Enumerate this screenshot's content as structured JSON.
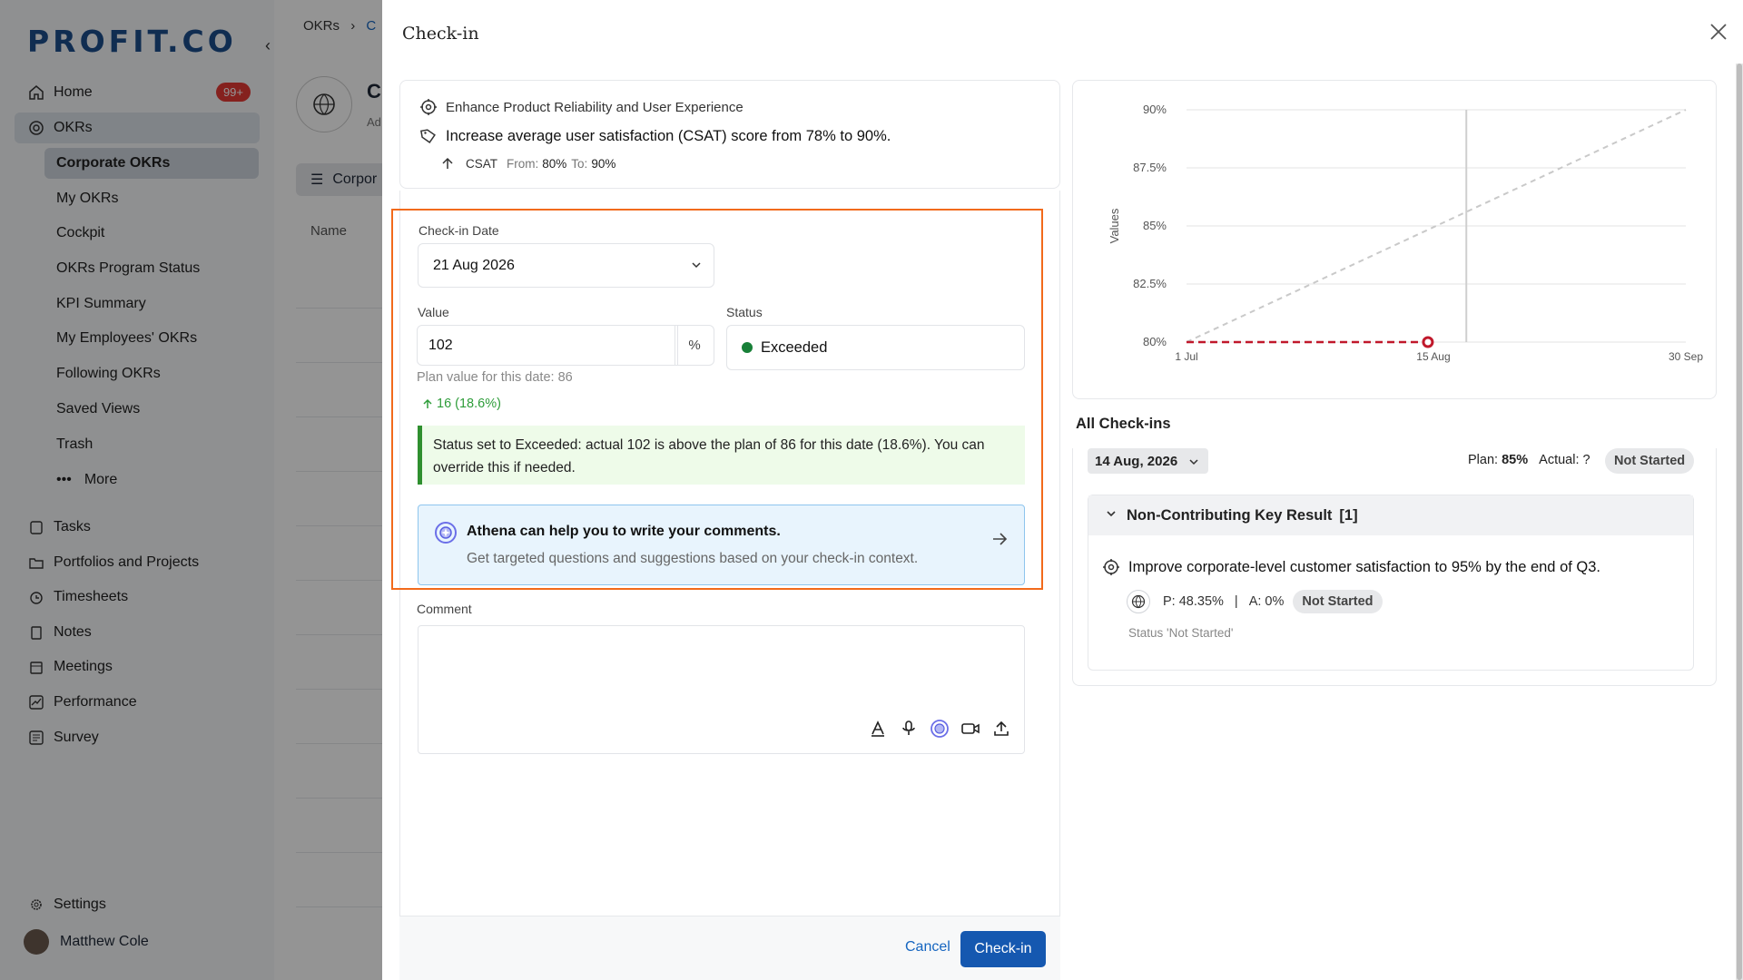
{
  "background": {
    "logo": "PROFIT.CO",
    "nav": [
      {
        "label": "Home",
        "badge": "99+"
      },
      {
        "label": "OKRs"
      },
      {
        "label": "Tasks"
      },
      {
        "label": "Portfolios and Projects"
      },
      {
        "label": "Timesheets"
      },
      {
        "label": "Notes"
      },
      {
        "label": "Meetings"
      },
      {
        "label": "Performance"
      },
      {
        "label": "Survey"
      }
    ],
    "okr_sub": [
      "Corporate OKRs",
      "My OKRs",
      "Cockpit",
      "OKRs Program Status",
      "KPI Summary",
      "My Employees' OKRs",
      "Following OKRs",
      "Saved Views",
      "Trash",
      "More"
    ],
    "settings": "Settings",
    "user": "Matthew Cole",
    "breadcrumb": [
      "OKRs",
      "C"
    ],
    "page_title": "C",
    "page_sub": "Ad",
    "filter": "Corpor",
    "name_col": "Name"
  },
  "drawer": {
    "title": "Check-in",
    "objective": "Enhance Product Reliability and User Experience",
    "key_result": "Increase average user satisfaction (CSAT) score from 78% to 90%.",
    "metric": "CSAT",
    "from_label": "From:",
    "from_value": "80%",
    "to_label": "To:",
    "to_value": "90%",
    "checkin_date_label": "Check-in Date",
    "checkin_date": "21 Aug 2026",
    "value_label": "Value",
    "value": "102",
    "unit": "%",
    "status_label": "Status",
    "status": "Exceeded",
    "status_color": "#188038",
    "plan_note": "Plan value for this date: 86",
    "delta": "16 (18.6%)",
    "status_message": "Status set to Exceeded: actual 102 is above the plan of 86 for this date (18.6%). You can override this if needed.",
    "athena_title": "Athena can help you to write your comments.",
    "athena_sub": "Get targeted questions and suggestions based on your check-in context.",
    "comment_label": "Comment",
    "comment_value": "",
    "cancel": "Cancel",
    "checkin_button": "Check-in",
    "accent": "#1558b0",
    "highlight_color": "#f26a1b"
  },
  "chart_data": {
    "type": "line",
    "title": "",
    "xlabel": "",
    "ylabel": "Values",
    "x_ticks": [
      "1 Jul",
      "15 Aug",
      "30 Sep"
    ],
    "y_ticks": [
      "80%",
      "82.5%",
      "85%",
      "87.5%",
      "90%"
    ],
    "ylim": [
      80,
      90
    ],
    "series": [
      {
        "name": "",
        "style": "dashed-gray",
        "x": [
          "1 Jul",
          "30 Sep"
        ],
        "y": [
          80,
          90
        ]
      },
      {
        "name": "",
        "style": "dashed-red",
        "x": [
          "1 Jul",
          "14 Aug"
        ],
        "y": [
          80,
          80
        ]
      }
    ],
    "current_date_line": "21 Aug",
    "grid": true
  },
  "all_checkins": {
    "title": "All Check-ins",
    "date": "14 Aug, 2026",
    "plan_label": "Plan:",
    "plan_value": "85%",
    "actual_label": "Actual:",
    "actual_value": "?",
    "status": "Not Started",
    "group_title": "Non-Contributing Key Result",
    "group_count": "[1]",
    "kr_title": "Improve corporate-level customer satisfaction to 95% by the end of Q3.",
    "kr_plan": "P: 48.35%",
    "separator": "|",
    "kr_actual": "A: 0%",
    "kr_status": "Not Started",
    "kr_note": "Status 'Not Started'"
  }
}
